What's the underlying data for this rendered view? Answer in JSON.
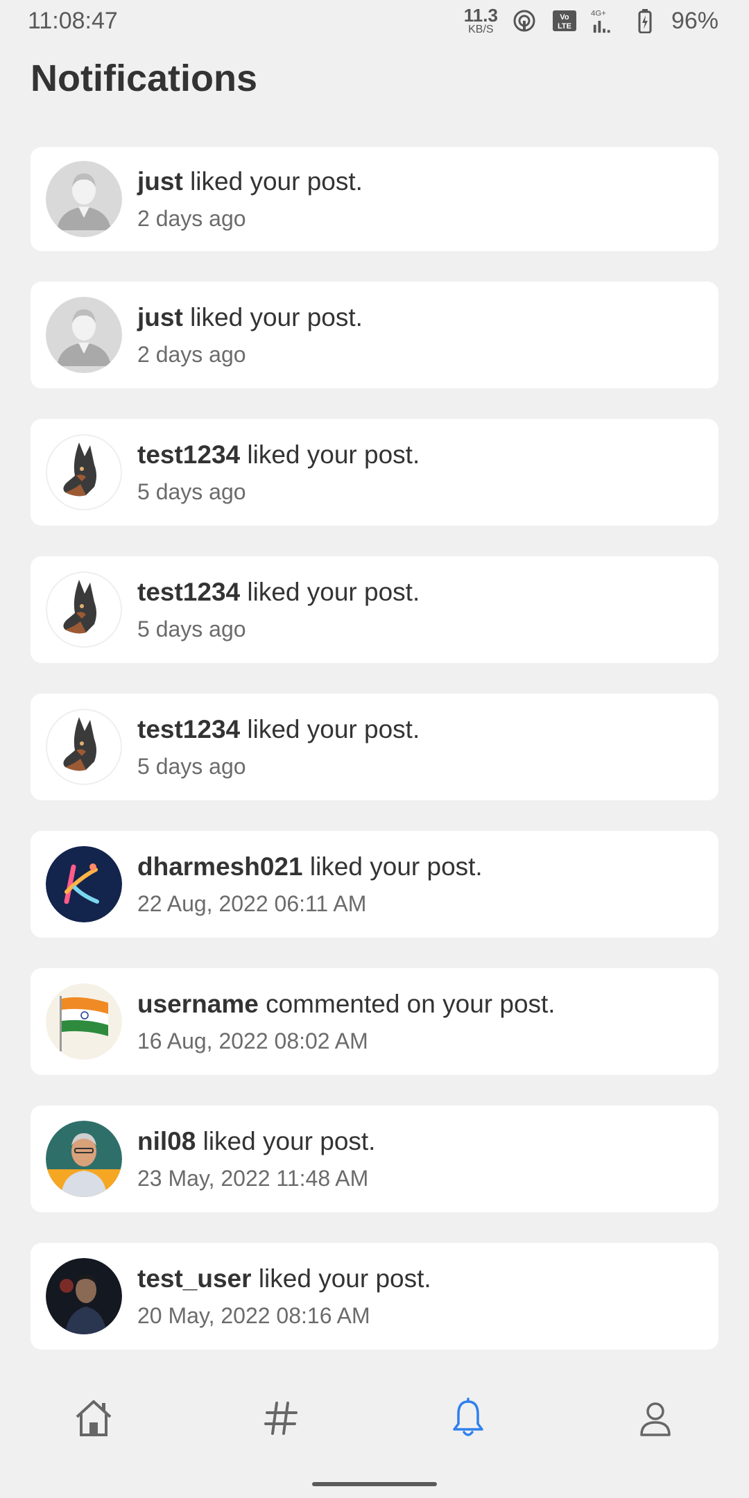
{
  "status_bar": {
    "time": "11:08:47",
    "net_speed_value": "11.3",
    "net_speed_unit": "KB/S",
    "volte": "Vo LTE",
    "network": "4G+",
    "battery": "96%"
  },
  "page_title": "Notifications",
  "notifications": [
    {
      "user": "just",
      "action": "liked your post.",
      "time": "2 days ago",
      "avatar": "default-person-avatar"
    },
    {
      "user": "just",
      "action": "liked your post.",
      "time": "2 days ago",
      "avatar": "default-person-avatar"
    },
    {
      "user": "test1234",
      "action": "liked your post.",
      "time": "5 days ago",
      "avatar": "dog-avatar"
    },
    {
      "user": "test1234",
      "action": "liked your post.",
      "time": "5 days ago",
      "avatar": "dog-avatar"
    },
    {
      "user": "test1234",
      "action": "liked your post.",
      "time": "5 days ago",
      "avatar": "dog-avatar"
    },
    {
      "user": "dharmesh021",
      "action": "liked your post.",
      "time": "22 Aug, 2022 06:11 AM",
      "avatar": "logo-avatar"
    },
    {
      "user": "username",
      "action": "commented on your post.",
      "time": "16 Aug, 2022 08:02 AM",
      "avatar": "flag-avatar"
    },
    {
      "user": "nil08",
      "action": "liked your post.",
      "time": "23 May, 2022 11:48 AM",
      "avatar": "photo-avatar"
    },
    {
      "user": "test_user",
      "action": "liked your post.",
      "time": "20 May, 2022 08:16 AM",
      "avatar": "photo-avatar-dark"
    }
  ],
  "bottom_nav": [
    {
      "icon": "home-icon",
      "active": false
    },
    {
      "icon": "hashtag-icon",
      "active": false
    },
    {
      "icon": "bell-icon",
      "active": true
    },
    {
      "icon": "profile-icon",
      "active": false
    }
  ],
  "colors": {
    "background": "#f0f0f0",
    "card": "#ffffff",
    "accent": "#2f80ed",
    "nav_inactive": "#666666"
  }
}
